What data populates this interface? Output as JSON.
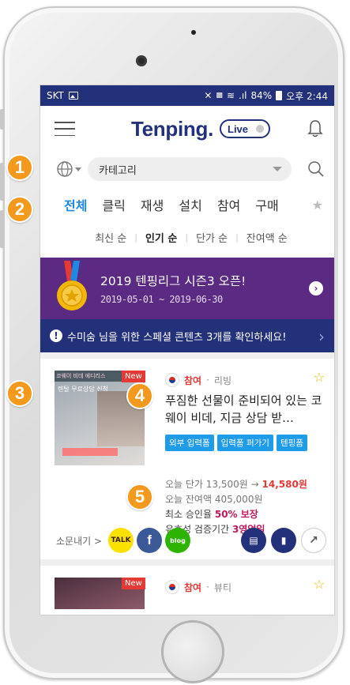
{
  "status_bar": {
    "carrier": "SKT",
    "battery": "84%",
    "time": "오후 2:44"
  },
  "header": {
    "logo": "Tenping.",
    "live_label": "Live"
  },
  "search": {
    "category_placeholder": "카테고리"
  },
  "tabs": [
    {
      "label": "전체",
      "active": true
    },
    {
      "label": "클릭"
    },
    {
      "label": "재생"
    },
    {
      "label": "설치"
    },
    {
      "label": "참여"
    },
    {
      "label": "구매"
    }
  ],
  "sort_options": [
    {
      "label": "최신 순"
    },
    {
      "label": "인기 순",
      "active": true
    },
    {
      "label": "단가 순"
    },
    {
      "label": "잔여액 순"
    }
  ],
  "league_banner": {
    "title": "2019 텐핑리그 시즌3 오픈!",
    "dates": "2019-05-01 ~ 2019-06-30"
  },
  "notice": {
    "text": "수미숨 님을 위한 스페셜 콘텐츠 3개를 확인하세요!"
  },
  "campaign": {
    "badge": "New",
    "type": "참여",
    "category": "리빙",
    "title": "푸짐한 선물이 준비되어 있는 코웨이 비데, 지금 상담 받…",
    "thumb_tag": "코웨이 비데 에디리스",
    "thumb_line": "렌탈 무료상담 신청",
    "tags": [
      "외부 입력폼",
      "입력폼 퍼가기",
      "텐핑폼"
    ],
    "price_prefix": "오늘 단가 13,500원 →",
    "price_new": "14,580원",
    "remaining": "오늘 잔여액 405,000원",
    "approval_label": "최소 승인율",
    "approval_value": "50% 보장",
    "validity_label": "유효성 검증기간",
    "validity_value": "3영업일",
    "share_label": "소문내기 >",
    "kakao": "TALK",
    "facebook": "f",
    "blog": "blog"
  },
  "campaign2": {
    "badge": "New",
    "type": "참여",
    "category": "뷰티"
  },
  "callouts": [
    "1",
    "2",
    "3",
    "4",
    "5"
  ],
  "colors": {
    "brand_navy": "#23307a",
    "accent_blue": "#1e88e5",
    "league_purple": "#5b2a82",
    "callout_orange": "#f39a1e",
    "price_red": "#e53935"
  }
}
